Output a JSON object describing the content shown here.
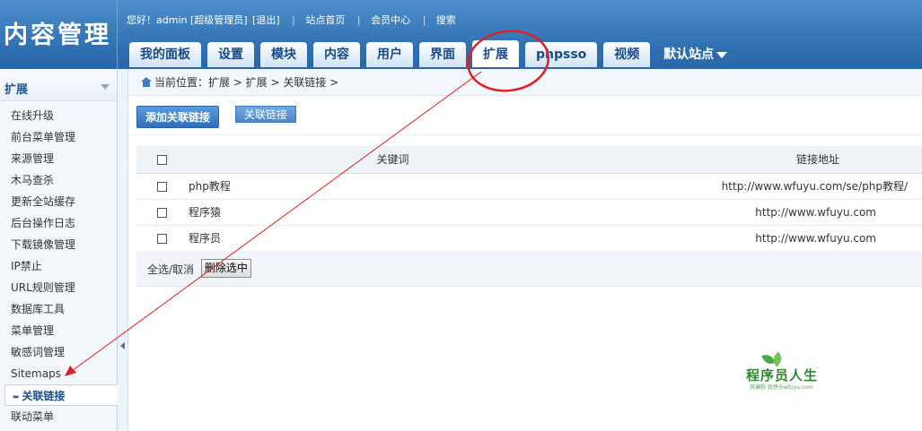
{
  "app": {
    "logo_text": "内容管理"
  },
  "topbar": {
    "greeting": "您好！admin [超级管理员]",
    "logout": "[退出]",
    "site_home": "站点首页",
    "member_center": "会员中心",
    "search": "搜索"
  },
  "nav": {
    "tabs": [
      {
        "label": "我的面板"
      },
      {
        "label": "设置"
      },
      {
        "label": "模块"
      },
      {
        "label": "内容"
      },
      {
        "label": "用户"
      },
      {
        "label": "界面"
      },
      {
        "label": "扩展"
      },
      {
        "label": "phpsso"
      },
      {
        "label": "视频"
      }
    ],
    "active_tab": "扩展",
    "site_select": "默认站点"
  },
  "sidebar": {
    "title": "扩展",
    "items": [
      {
        "label": "在线升级"
      },
      {
        "label": "前台菜单管理"
      },
      {
        "label": "来源管理"
      },
      {
        "label": "木马查杀"
      },
      {
        "label": "更新全站缓存"
      },
      {
        "label": "后台操作日志"
      },
      {
        "label": "下载镜像管理"
      },
      {
        "label": "IP禁止"
      },
      {
        "label": "URL规则管理"
      },
      {
        "label": "数据库工具"
      },
      {
        "label": "菜单管理"
      },
      {
        "label": "敏感词管理"
      },
      {
        "label": "Sitemaps"
      },
      {
        "label": "关联链接"
      },
      {
        "label": "联动菜单"
      }
    ],
    "active_item": "关联链接"
  },
  "breadcrumb": {
    "text": "当前位置：扩展 > 扩展 > 关联链接 >"
  },
  "actions": {
    "add_label": "添加关联链接",
    "list_label": "关联链接"
  },
  "table": {
    "headers": {
      "keyword": "关键词",
      "url": "链接地址"
    },
    "rows": [
      {
        "keyword": "php教程",
        "url": "http://www.wfuyu.com/se/php教程/"
      },
      {
        "keyword": "程序猿",
        "url": "http://www.wfuyu.com"
      },
      {
        "keyword": "程序员",
        "url": "http://www.wfuyu.com"
      }
    ]
  },
  "footer": {
    "select_all": "全选/取消",
    "delete_selected": "删除选中"
  },
  "watermark": {
    "text": "程序员人生",
    "sub": "我编程 我快乐wfuyu.com"
  },
  "colors": {
    "header_blue": "#2f70b2",
    "tab_text": "#174a86",
    "annotation_red": "#e02020",
    "watermark_green": "#2d8a2a"
  }
}
